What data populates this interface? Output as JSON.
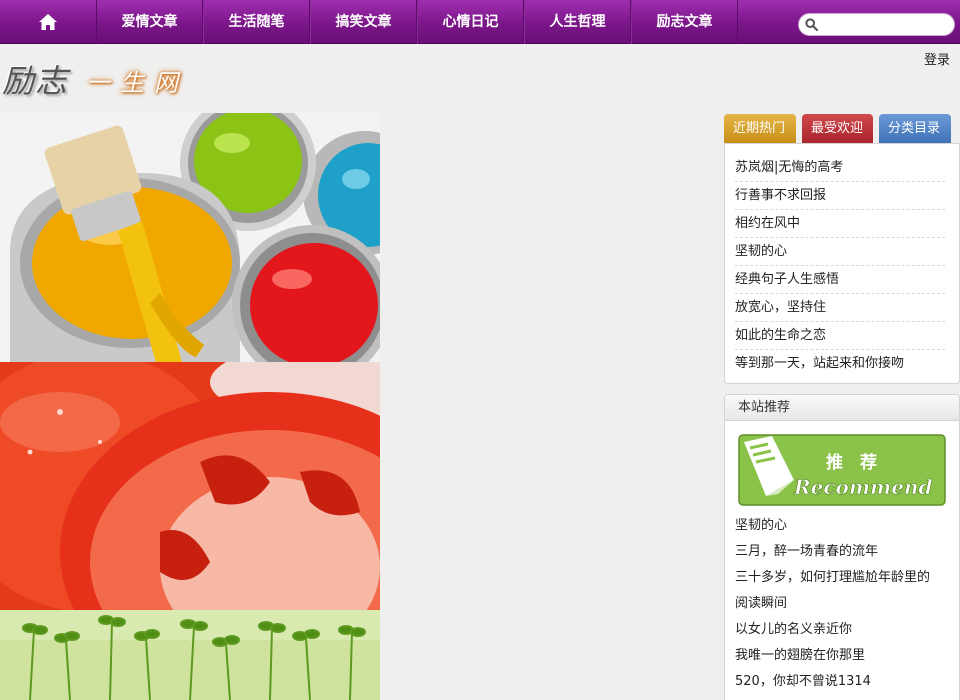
{
  "nav": {
    "home_icon": "home-icon",
    "items": [
      "爱情文章",
      "生活随笔",
      "搞笑文章",
      "心情日记",
      "人生哲理",
      "励志文章"
    ],
    "search_icon": "search-icon",
    "search_placeholder": "",
    "accent_color": "#7b1689"
  },
  "header": {
    "login": "登录",
    "logo_main": "励志",
    "logo_sub": "一生网"
  },
  "sidebar": {
    "tabs": [
      "近期热门",
      "最受欢迎",
      "分类目录"
    ],
    "hot_items": [
      "苏岚烟|无悔的高考",
      "行善事不求回报",
      "相约在风中",
      "坚韧的心",
      "经典句子人生感悟",
      "放宽心，坚持住",
      "如此的生命之恋",
      "等到那一天，站起来和你接吻"
    ],
    "recommend": {
      "title": "本站推荐",
      "banner_cn": "推　荐",
      "banner_en": "Recommend",
      "banner_color": "#8bc34a",
      "items": [
        "坚韧的心",
        "三月，醉一场青春的流年",
        "三十多岁，如何打理尴尬年龄里的",
        "阅读瞬间",
        "以女儿的名义亲近你",
        "我唯一的翅膀在你那里",
        "520，你却不曾说1314"
      ]
    }
  }
}
